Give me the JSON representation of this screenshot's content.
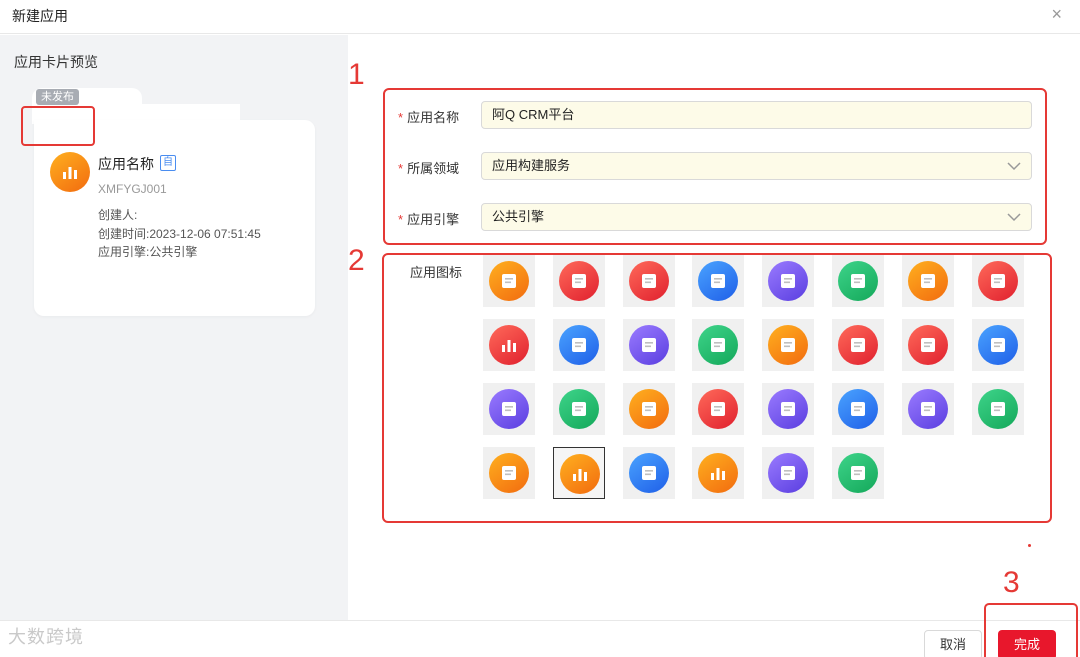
{
  "dialog": {
    "title": "新建应用",
    "close_glyph": "×"
  },
  "preview": {
    "label": "应用卡片预览",
    "status_badge": "未发布",
    "app_name": "应用名称",
    "name_tag": "自",
    "app_code": "XMFYGJ001",
    "creator": "创建人:",
    "created_time": "创建时间:2023-12-06 07:51:45",
    "engine": "应用引擎:公共引擎"
  },
  "annotations": {
    "form": "1",
    "icons": "2",
    "done": "3",
    "color": "#e53935"
  },
  "form": {
    "required_mark": "*",
    "app_name": {
      "label": "应用名称",
      "value": "阿Q CRM平台"
    },
    "domain": {
      "label": "所属领域",
      "value": "应用构建服务"
    },
    "engine": {
      "label": "应用引擎",
      "value": "公共引擎"
    },
    "icon_label": "应用图标"
  },
  "icons": [
    {
      "name": "briefcase-clock-icon",
      "from": "#ffb01f",
      "to": "#f26b0f"
    },
    {
      "name": "monitor-icon",
      "from": "#ff6a5a",
      "to": "#e0202e"
    },
    {
      "name": "clipboard-edit-icon",
      "from": "#ff6a5a",
      "to": "#e0202e"
    },
    {
      "name": "document-gear-icon",
      "from": "#4aa3ff",
      "to": "#1f5fe8"
    },
    {
      "name": "clipboard-check-icon",
      "from": "#9a7bff",
      "to": "#5a3ee0"
    },
    {
      "name": "folder-gear-icon",
      "from": "#3ed48a",
      "to": "#14a85a"
    },
    {
      "name": "clipboard-settings-icon",
      "from": "#ffb01f",
      "to": "#f26b0f"
    },
    {
      "name": "inbox-download-icon",
      "from": "#ff6a5a",
      "to": "#e0202e"
    },
    {
      "name": "bar-chart-board-icon",
      "from": "#ff6a5a",
      "to": "#e0202e"
    },
    {
      "name": "clipboard-list-icon",
      "from": "#4aa3ff",
      "to": "#1f5fe8"
    },
    {
      "name": "toolbox-icon",
      "from": "#9a7bff",
      "to": "#5a3ee0"
    },
    {
      "name": "book-icon",
      "from": "#3ed48a",
      "to": "#14a85a"
    },
    {
      "name": "checklist-gear-icon",
      "from": "#ffb01f",
      "to": "#f26b0f"
    },
    {
      "name": "medical-box-icon",
      "from": "#ff6a5a",
      "to": "#e0202e"
    },
    {
      "name": "binders-icon",
      "from": "#ff6a5a",
      "to": "#e0202e"
    },
    {
      "name": "document-lines-icon",
      "from": "#4aa3ff",
      "to": "#1f5fe8"
    },
    {
      "name": "folder-list-icon",
      "from": "#9a7bff",
      "to": "#5a3ee0"
    },
    {
      "name": "storage-box-icon",
      "from": "#3ed48a",
      "to": "#14a85a"
    },
    {
      "name": "file-text-icon",
      "from": "#ffb01f",
      "to": "#f26b0f"
    },
    {
      "name": "file-pie-icon",
      "from": "#ff6a5a",
      "to": "#e0202e"
    },
    {
      "name": "tray-user-icon",
      "from": "#9a7bff",
      "to": "#5a3ee0"
    },
    {
      "name": "document-search-icon",
      "from": "#4aa3ff",
      "to": "#1f5fe8"
    },
    {
      "name": "document-user-icon",
      "from": "#9a7bff",
      "to": "#5a3ee0"
    },
    {
      "name": "file-check-icon",
      "from": "#3ed48a",
      "to": "#14a85a"
    },
    {
      "name": "search-check-icon",
      "from": "#ffb01f",
      "to": "#f26b0f"
    },
    {
      "name": "bar-chart-icon",
      "from": "#ffb01f",
      "to": "#f26b0f",
      "selected": true
    },
    {
      "name": "document-edit-icon",
      "from": "#4aa3ff",
      "to": "#1f5fe8"
    },
    {
      "name": "bar-chart-alt-icon",
      "from": "#ffb01f",
      "to": "#f26b0f"
    },
    {
      "name": "trend-line-icon",
      "from": "#9a7bff",
      "to": "#5a3ee0"
    },
    {
      "name": "spreadsheet-icon",
      "from": "#3ed48a",
      "to": "#14a85a"
    }
  ],
  "footer": {
    "watermark": "大数跨境",
    "cancel_label": "取消",
    "done_label": "完成",
    "primary_color": "#e8172c"
  }
}
